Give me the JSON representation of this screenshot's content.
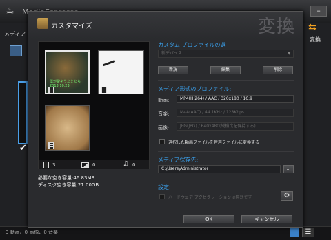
{
  "background_app": {
    "title": "MediaEspresso",
    "side_tab": "メディア",
    "convert_label": "変換",
    "status_text": "3 動画、0 画像、0 音楽",
    "minimize_glyph": "–"
  },
  "dialog": {
    "title": "カスタマイズ",
    "big_label": "変換",
    "preview": {
      "thumb1_caption": "僕が愛をうたえたら\n2013.10.23",
      "video_count": "3",
      "image_count": "0",
      "music_count": "0"
    },
    "required_space": "必要な空き容量:46.83MB",
    "disk_space": "ディスク空き容量:21.00GB",
    "custom_profile": {
      "heading": "カスタム プロファイルの選",
      "selected": "新デバイス",
      "btn_new": "新規",
      "btn_edit": "編集",
      "btn_delete": "削除"
    },
    "media_profile": {
      "heading": "メディア形式のプロファイル:",
      "video_label": "動画:",
      "video_value": "MP4(H.264) / AAC / 320x180 / 16:9",
      "audio_label": "音楽:",
      "audio_value": "M4A(AAC) / 44.1KHz / 128Kbps",
      "image_label": "画像:",
      "image_value": "JPG(JPG) / 640x480(縦横比を保持する)",
      "convert_audio_checkbox": "選択した動画ファイルを音声ファイルに変換する"
    },
    "save_dest": {
      "heading": "メディア保存先:",
      "path": "C:\\Users\\Administrator",
      "browse": "..."
    },
    "settings": {
      "heading": "設定:",
      "hw_accel": "ハードウェア アクセラレーションは無効です"
    },
    "ok": "OK",
    "cancel": "キャンセル"
  }
}
